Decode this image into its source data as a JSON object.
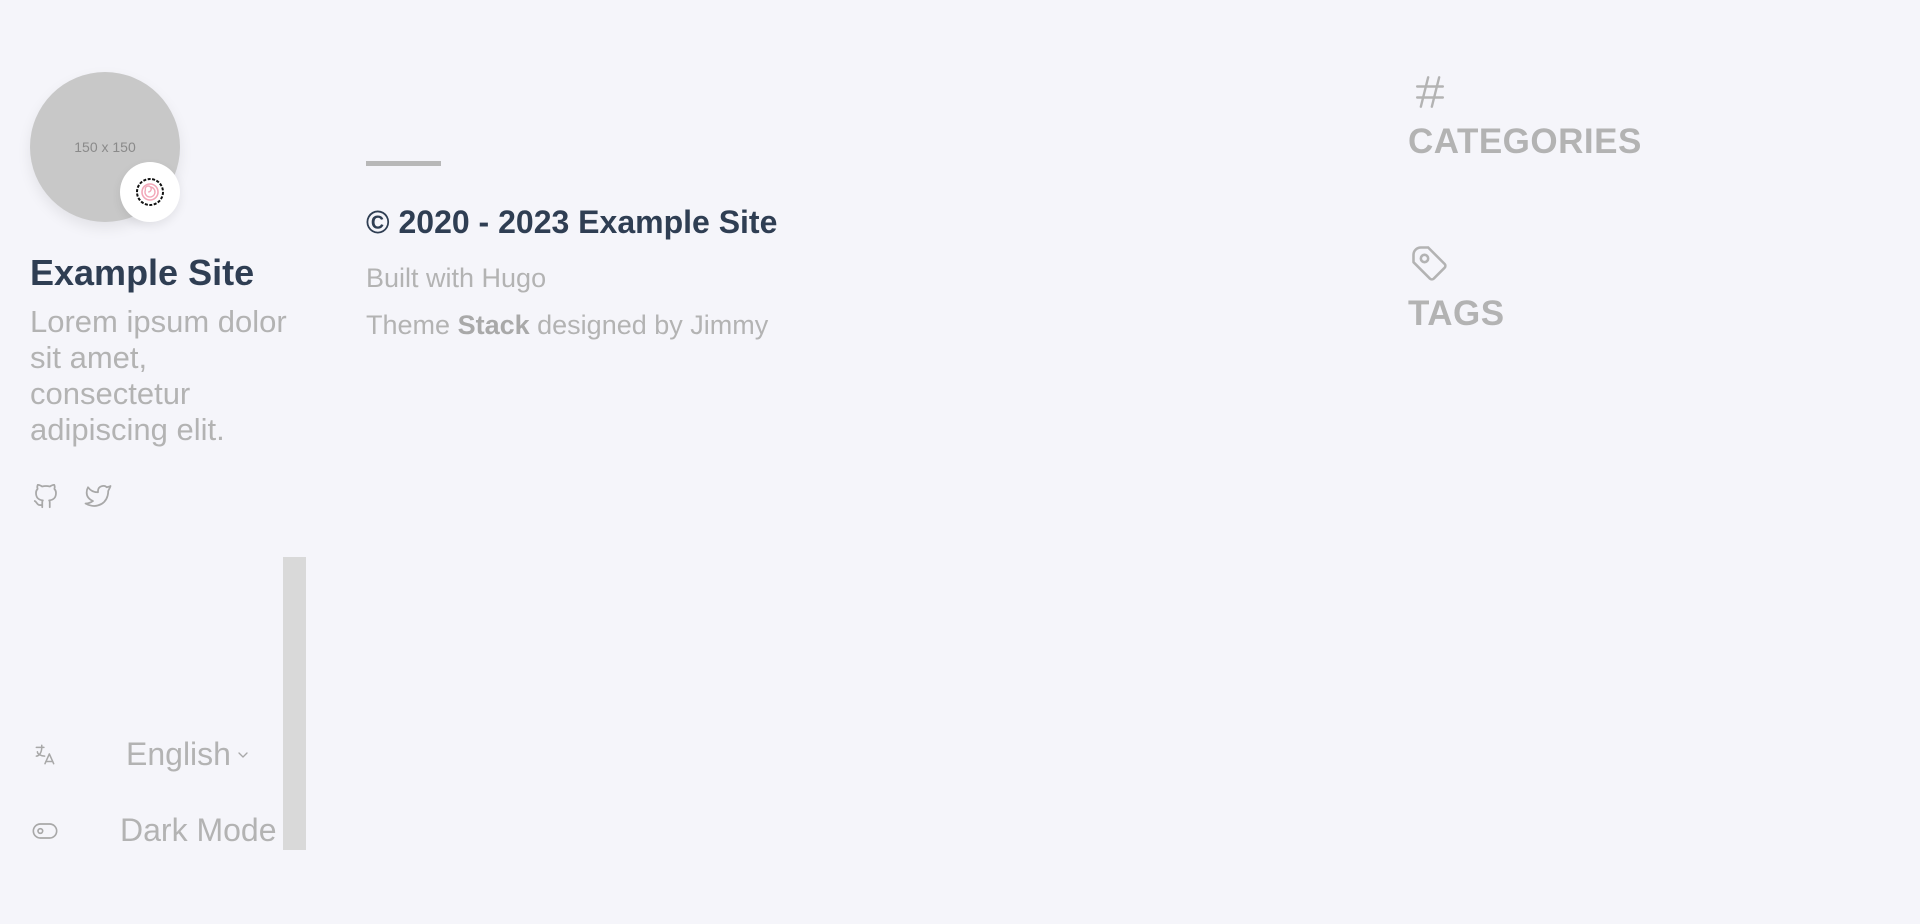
{
  "sidebar": {
    "avatar_placeholder": "150 x 150",
    "emoji_icon": "snail-shell-icon",
    "site_name": "Example Site",
    "description": "Lorem ipsum dolor sit amet, consectetur adipiscing elit.",
    "social": [
      {
        "name": "github-icon"
      },
      {
        "name": "twitter-icon"
      }
    ],
    "language": {
      "icon": "translate-icon",
      "value": "English"
    },
    "dark_mode": {
      "icon": "toggle-icon",
      "label": "Dark Mode"
    }
  },
  "footer": {
    "copyright": "© 2020 - 2023 Example Site",
    "built_with": "Built with Hugo",
    "theme_prefix": "Theme",
    "theme_name": "Stack",
    "theme_suffix": "designed by Jimmy"
  },
  "widgets": {
    "categories": {
      "icon": "hash-icon",
      "title": "CATEGORIES"
    },
    "tags": {
      "icon": "tag-icon",
      "title": "TAGS"
    }
  },
  "colors": {
    "background": "#f5f5fa",
    "heading": "#2f3e53",
    "muted": "#b3b3b3",
    "avatar": "#c8c8c8",
    "scrollbar": "#d9d9d9"
  }
}
